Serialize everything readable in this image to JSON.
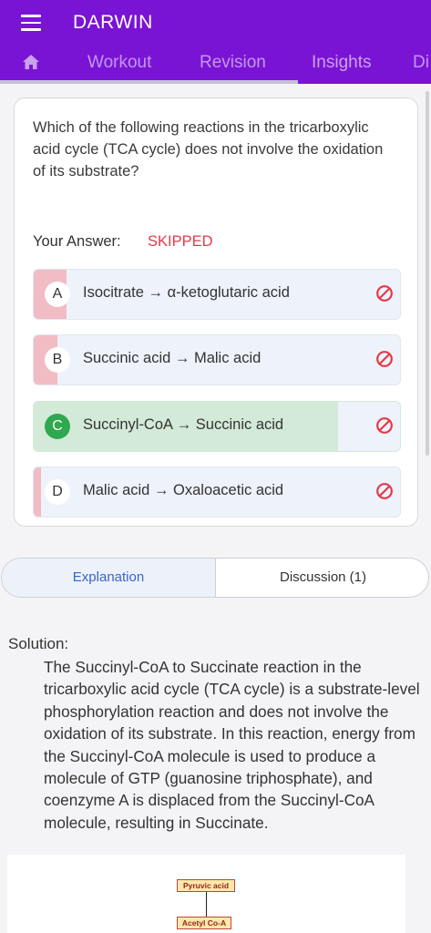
{
  "app": {
    "title": "DARWIN"
  },
  "tabs": {
    "home_icon": "home-icon",
    "items": [
      "Workout",
      "Revision",
      "Insights",
      "Di"
    ]
  },
  "question": {
    "text": "Which of the following reactions in the tricarboxylic acid cycle (TCA cycle) does not involve the oxidation of its substrate?",
    "answer_label": "Your Answer:",
    "answer_value": "SKIPPED"
  },
  "options": [
    {
      "letter": "A",
      "text": "Isocitrate → α-ketoglutaric acid"
    },
    {
      "letter": "B",
      "text": "Succinic acid → Malic acid"
    },
    {
      "letter": "C",
      "text": "Succinyl-CoA → Succinic acid"
    },
    {
      "letter": "D",
      "text": "Malic acid → Oxaloacetic acid"
    }
  ],
  "segment": {
    "explanation": "Explanation",
    "discussion": "Discussion (1)"
  },
  "solution": {
    "title": "Solution:",
    "body": "The Succinyl-CoA to Succinate reaction in the tricarboxylic acid cycle (TCA cycle) is a substrate-level phosphorylation reaction and does not involve the oxidation of its substrate. In this reaction, energy from the Succinyl-CoA molecule is used to produce a molecule of GTP (guanosine triphosphate), and coenzyme A is displaced from the Succinyl-CoA molecule, resulting in Succinate."
  },
  "diagram": {
    "node1": "Pyruvic acid",
    "node2": "Acetyl Co-A"
  },
  "colors": {
    "primary": "#7a14d4",
    "wrong": "#e53949",
    "correct": "#2fa84f",
    "link": "#3a63c8"
  }
}
